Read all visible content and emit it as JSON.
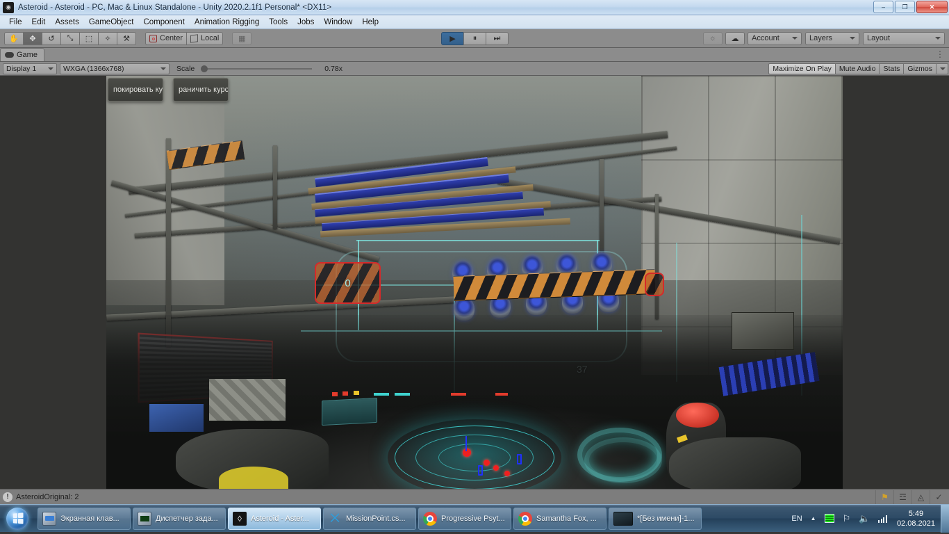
{
  "window": {
    "title": "Asteroid - Asteroid - PC, Mac & Linux Standalone - Unity 2020.2.1f1 Personal* <DX11>",
    "app_icon": "unity-icon",
    "minimize_glyph": "–",
    "restore_glyph": "❐",
    "close_glyph": "✕"
  },
  "menubar": {
    "items": [
      {
        "label": "File"
      },
      {
        "label": "Edit"
      },
      {
        "label": "Assets"
      },
      {
        "label": "GameObject"
      },
      {
        "label": "Component"
      },
      {
        "label": "Animation Rigging"
      },
      {
        "label": "Tools"
      },
      {
        "label": "Jobs"
      },
      {
        "label": "Window"
      },
      {
        "label": "Help"
      }
    ]
  },
  "toolbar": {
    "tools": [
      {
        "name": "hand-tool",
        "glyph": "✋",
        "active": false
      },
      {
        "name": "move-tool",
        "glyph": "✥",
        "active": true
      },
      {
        "name": "rotate-tool",
        "glyph": "↺",
        "active": false
      },
      {
        "name": "scale-tool",
        "glyph": "⤡",
        "active": false
      },
      {
        "name": "rect-tool",
        "glyph": "⬚",
        "active": false
      },
      {
        "name": "transform-tool",
        "glyph": "✧",
        "active": false
      },
      {
        "name": "custom-tool",
        "glyph": "⚒",
        "active": false
      }
    ],
    "pivot_mode": "Center",
    "pivot_rotation": "Local",
    "grid_snap_label": "",
    "play": "▶",
    "pause": "⏸",
    "step": "⏭",
    "collab_icon": "cloud-icon",
    "services_icon": "services-icon",
    "account": "Account",
    "layers": "Layers",
    "layout": "Layout"
  },
  "game_tab": {
    "label": "Game",
    "icon": "gamepad-icon",
    "menu_glyph": "⋮"
  },
  "gameview_bar": {
    "display": "Display 1",
    "resolution": "WXGA (1366x768)",
    "scale_label": "Scale",
    "scale_value": "0.78x",
    "maximize_on_play": "Maximize On Play",
    "mute_audio": "Mute Audio",
    "stats": "Stats",
    "gizmos": "Gizmos"
  },
  "game_overlay": {
    "buttons": [
      {
        "label": "покировать кур",
        "name": "lock-cursor-button"
      },
      {
        "label": "раничить курсо",
        "name": "limit-cursor-button"
      }
    ],
    "hud_markers": [
      {
        "value": "0",
        "name": "target-marker-zero"
      },
      {
        "value": "37",
        "name": "target-marker-37"
      }
    ]
  },
  "status_bar": {
    "warning_glyph": "!",
    "message": "AsteroidOriginal: 2",
    "icons": [
      {
        "name": "collab-warning-icon",
        "glyph": "⚠"
      },
      {
        "name": "layers-icon",
        "glyph": "☲"
      },
      {
        "name": "visibility-off-icon",
        "glyph": "◬"
      },
      {
        "name": "check-circle-icon",
        "glyph": "✓"
      }
    ]
  },
  "taskbar": {
    "start_label": "start",
    "tasks": [
      {
        "label": "Экранная клав...",
        "icon": "onscreen-keyboard-icon",
        "active": false,
        "color": "#3a6ea5"
      },
      {
        "label": "Диспетчер зада...",
        "icon": "task-manager-icon",
        "active": false,
        "color": "#2f6b3f"
      },
      {
        "label": "Asteroid - Aster...",
        "icon": "unity-icon",
        "active": true,
        "color": "#1a1a1a"
      },
      {
        "label": "MissionPoint.cs...",
        "icon": "vscode-icon",
        "active": false,
        "color": "#1f7fc4"
      },
      {
        "label": "Progressive Psyt...",
        "icon": "chrome-icon",
        "active": false,
        "color": "#ffffff"
      },
      {
        "label": "Samantha Fox, ...",
        "icon": "chrome-icon",
        "active": false,
        "color": "#ffffff"
      },
      {
        "label": "*[Без имени]-1...",
        "icon": "image-editor-icon",
        "active": false,
        "color": "#2a3a44"
      }
    ],
    "tray": {
      "language": "EN",
      "show_hidden_glyph": "▲",
      "icons": [
        {
          "name": "green-indicator-icon"
        },
        {
          "name": "network-flag-icon",
          "glyph": "⚑"
        },
        {
          "name": "volume-icon",
          "glyph": "ὐA"
        },
        {
          "name": "signal-icon"
        }
      ],
      "time": "5:49",
      "date": "02.08.2021"
    }
  },
  "colors": {
    "unity_chrome": "#8c8c8c",
    "play_active": "#3d6e9e",
    "hud_cyan": "#7fe9e4",
    "hud_red": "#d62a2a",
    "taskbar_blue": "#2d4a65"
  }
}
